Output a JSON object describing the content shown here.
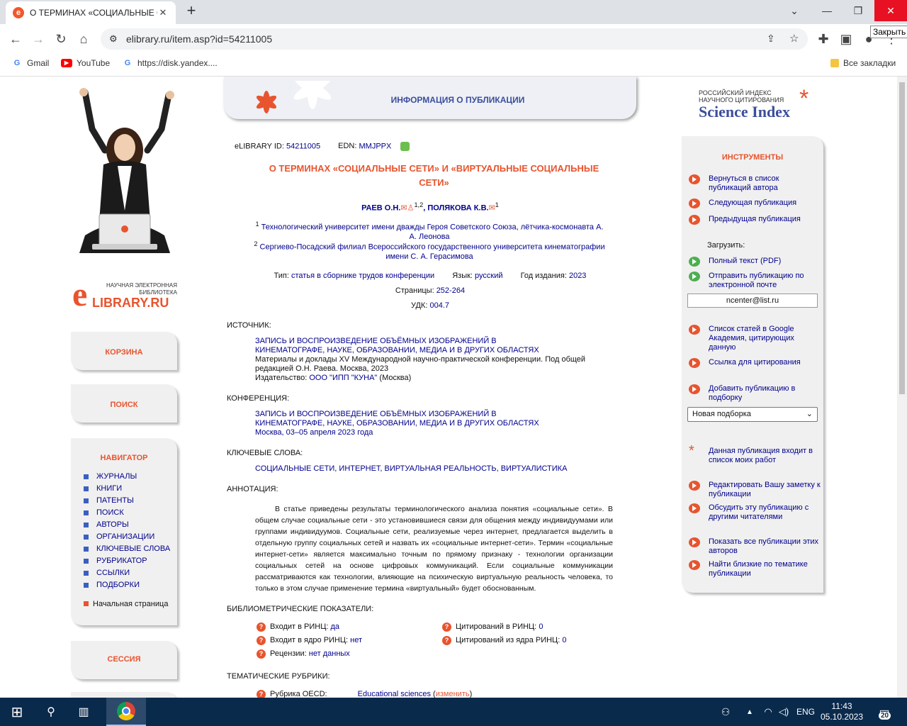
{
  "browser": {
    "tab_title": "О ТЕРМИНАХ «СОЦИАЛЬНЫЕ С",
    "url": "elibrary.ru/item.asp?id=54211005",
    "tooltip": "Закрыть",
    "bookmarks": [
      "Gmail",
      "YouTube",
      "https://disk.yandex...."
    ],
    "all_bookmarks": "Все закладки"
  },
  "left": {
    "logo_line1": "НАУЧНАЯ ЭЛЕКТРОННАЯ",
    "logo_line2": "БИБЛИОТЕКА",
    "logo_brand": "LIBRARY.RU",
    "logo_e": "e",
    "cart": "КОРЗИНА",
    "search": "ПОИСК",
    "navigator_title": "НАВИГАТОР",
    "nav_items": [
      "ЖУРНАЛЫ",
      "КНИГИ",
      "ПАТЕНТЫ",
      "ПОИСК",
      "АВТОРЫ",
      "ОРГАНИЗАЦИИ",
      "КЛЮЧЕВЫЕ СЛОВА",
      "РУБРИКАТОР",
      "ССЫЛКИ",
      "ПОДБОРКИ"
    ],
    "home": "Начальная страница",
    "session": "СЕССИЯ"
  },
  "header": {
    "banner": "ИНФОРМАЦИЯ О ПУБЛИКАЦИИ"
  },
  "pub": {
    "id_label": "eLIBRARY ID:",
    "id": "54211005",
    "edn_label": "EDN:",
    "edn": "MMJPPX",
    "title": "О ТЕРМИНАХ «СОЦИАЛЬНЫЕ СЕТИ» И «ВИРТУАЛЬНЫЕ СОЦИАЛЬНЫЕ СЕТИ»",
    "author1": "РАЕВ О.Н.",
    "author1_sup": "1,2",
    "author2": "ПОЛЯКОВА К.В.",
    "author2_sup": "1",
    "aff1_sup": "1",
    "aff1": "Технологический университет имени дважды Героя Советского Союза, лётчика-космонавта А. А. Леонова",
    "aff2_sup": "2",
    "aff2": "Сергиево-Посадский филиал Всероссийского государственного университета кинематографии имени С. А. Герасимова",
    "type_label": "Тип:",
    "type": "статья в сборнике трудов конференции",
    "lang_label": "Язык:",
    "lang": "русский",
    "year_label": "Год издания:",
    "year": "2023",
    "pages_label": "Страницы:",
    "pages": "252-264",
    "udk_label": "УДК:",
    "udk": "004.7",
    "source_label": "ИСТОЧНИК:",
    "source_title": "ЗАПИСЬ И ВОСПРОИЗВЕДЕНИЕ ОБЪЁМНЫХ ИЗОБРАЖЕНИЙ В КИНЕМАТОГРАФЕ, НАУКЕ, ОБРАЗОВАНИИ, МЕДИА И В ДРУГИХ ОБЛАСТЯХ",
    "source_desc": "Материалы и доклады XV Международной научно-практической конференции. Под общей редакцией О.Н. Раева. Москва, 2023",
    "publisher_label": "Издательство:",
    "publisher": "ООО \"ИПП \"КУНА\"",
    "publisher_city": "(Москва)",
    "conf_label": "КОНФЕРЕНЦИЯ:",
    "conf_title": "ЗАПИСЬ И ВОСПРОИЗВЕДЕНИЕ ОБЪЁМНЫХ ИЗОБРАЖЕНИЙ В КИНЕМАТОГРАФЕ, НАУКЕ, ОБРАЗОВАНИИ, МЕДИА И В ДРУГИХ ОБЛАСТЯХ",
    "conf_place": "Москва, 03–05 апреля 2023 года",
    "kw_label": "КЛЮЧЕВЫЕ СЛОВА:",
    "keywords": "СОЦИАЛЬНЫЕ СЕТИ, ИНТЕРНЕТ, ВИРТУАЛЬНАЯ РЕАЛЬНОСТЬ, ВИРТУАЛИСТИКА",
    "abs_label": "АННОТАЦИЯ:",
    "abstract": "В статье приведены результаты терминологического анализа понятия «социальные сети». В общем случае социальные сети - это установившиеся связи для общения между индивидуумами или группами индивидуумов. Социальные сети, реализуемые через интернет, предлагается выделить в отдельную группу социальных сетей и назвать их «социальные интернет-сети». Термин «социальные интернет-сети» является максимально точным по прямому признаку - технологии организации социальных сетей на основе цифровых коммуникаций. Если социальные коммуникации рассматриваются как технологии, влияющие на психическую виртуальную реальность человека, то только в этом случае применение термина «виртуальный» будет обоснованным.",
    "biblio_label": "БИБЛИОМЕТРИЧЕСКИЕ ПОКАЗАТЕЛИ:",
    "m1_label": "Входит в РИНЦ:",
    "m1": "да",
    "m2_label": "Цитирований в РИНЦ:",
    "m2": "0",
    "m3_label": "Входит в ядро РИНЦ:",
    "m3": "нет",
    "m4_label": "Цитирований из ядра РИНЦ:",
    "m4": "0",
    "m5_label": "Рецензии:",
    "m5": "нет данных",
    "rubrics_label": "ТЕМАТИЧЕСКИЕ РУБРИКИ:",
    "oecd_label": "Рубрика OECD:",
    "oecd": "Educational sciences",
    "change": "изменить"
  },
  "right": {
    "si_line1": "РОССИЙСКИЙ ИНДЕКС",
    "si_line2": "НАУЧНОГО ЦИТИРОВАНИЯ",
    "si_brand": "Science Index",
    "tools_title": "ИНСТРУМЕНТЫ",
    "t1": "Вернуться в список публикаций автора",
    "t2": "Следующая публикация",
    "t3": "Предыдущая публикация",
    "load_label": "Загрузить:",
    "t4": "Полный текст (PDF)",
    "t5": "Отправить публикацию по электронной почте",
    "email": "ncenter@list.ru",
    "t6": "Список статей в Google Академия, цитирующих данную",
    "t7": "Ссылка для цитирования",
    "t8": "Добавить публикацию в подборку",
    "collection": "Новая подборка",
    "t9": "Данная публикация входит в список моих работ",
    "t10": "Редактировать Вашу заметку к публикации",
    "t11": "Обсудить эту публикацию с другими читателями",
    "t12": "Показать все публикации этих авторов",
    "t13": "Найти близкие по тематике публикации"
  },
  "taskbar": {
    "lang": "ENG",
    "time": "11:43",
    "date": "05.10.2023",
    "notif": "20"
  },
  "colors": {
    "accent": "#e8542e",
    "link": "#00008b",
    "taskbar": "#0a2a4c"
  }
}
